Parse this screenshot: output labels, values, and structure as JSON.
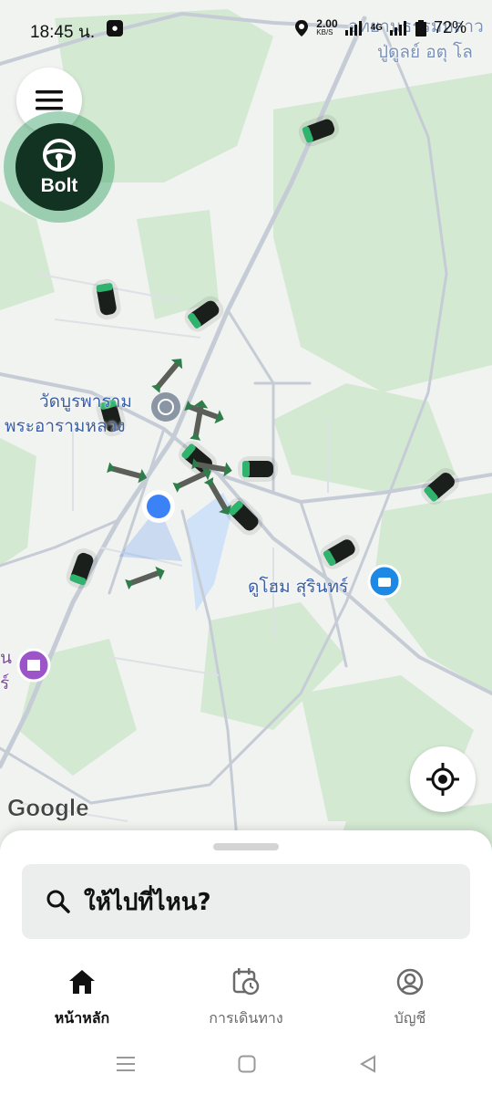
{
  "status_bar": {
    "time": "18:45 น.",
    "data_speed": "2.00",
    "data_unit": "KB/S",
    "network_type": "4G",
    "battery": "72%"
  },
  "map": {
    "labels": {
      "temple_line1": "วัดบูรพาราม",
      "temple_line2": "พระอารามหลวง",
      "mall": "ดูโฮม สุรินทร์",
      "top_right_line1": "อุทยานธรรมหลาว",
      "top_right_line2": "ปู่ดูลย์ อตุ โล",
      "left_edge_line1": "น",
      "left_edge_line2": "ร์"
    },
    "attribution": "Google",
    "user_location_color": "#3b82f6",
    "map_water_color": "#cfe2f7",
    "park_color": "#cfe8cf",
    "car_count": 12
  },
  "buttons": {
    "menu_icon": "hamburger-icon",
    "bolt_brand": "Bolt",
    "bolt_brand_color": "#123222",
    "locate_icon": "crosshair-icon"
  },
  "bottom_sheet": {
    "search_placeholder": "ให้ไปที่ไหน?",
    "tabs": [
      {
        "label": "หน้าหลัก",
        "icon": "home-icon",
        "active": true
      },
      {
        "label": "การเดินทาง",
        "icon": "calendar-clock-icon",
        "active": false
      },
      {
        "label": "บัญชี",
        "icon": "account-icon",
        "active": false
      }
    ]
  },
  "system_nav": [
    "recents-icon",
    "home-icon",
    "back-icon"
  ]
}
